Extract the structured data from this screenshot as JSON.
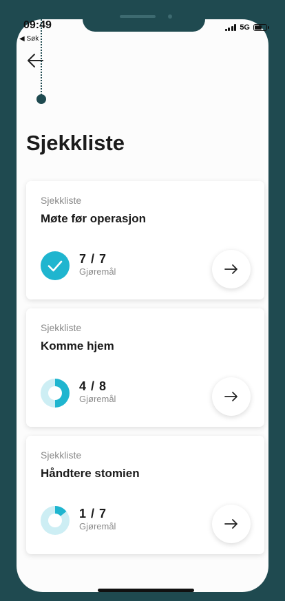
{
  "status": {
    "time": "09:49",
    "back_app": "◀ Søk",
    "network": "5G"
  },
  "header": {
    "title": "Sjekkliste"
  },
  "checklists": [
    {
      "kicker": "Sjekkliste",
      "title": "Møte før operasjon",
      "count": "7 / 7",
      "label": "Gjøremål",
      "done": 7,
      "total": 7
    },
    {
      "kicker": "Sjekkliste",
      "title": "Komme hjem",
      "count": "4 / 8",
      "label": "Gjøremål",
      "done": 4,
      "total": 8
    },
    {
      "kicker": "Sjekkliste",
      "title": "Håndtere stomien",
      "count": "1 / 7",
      "label": "Gjøremål",
      "done": 1,
      "total": 7
    }
  ],
  "colors": {
    "accent": "#1fb5cf",
    "accent_light": "#cdeef4",
    "frame": "#1f4a50"
  }
}
